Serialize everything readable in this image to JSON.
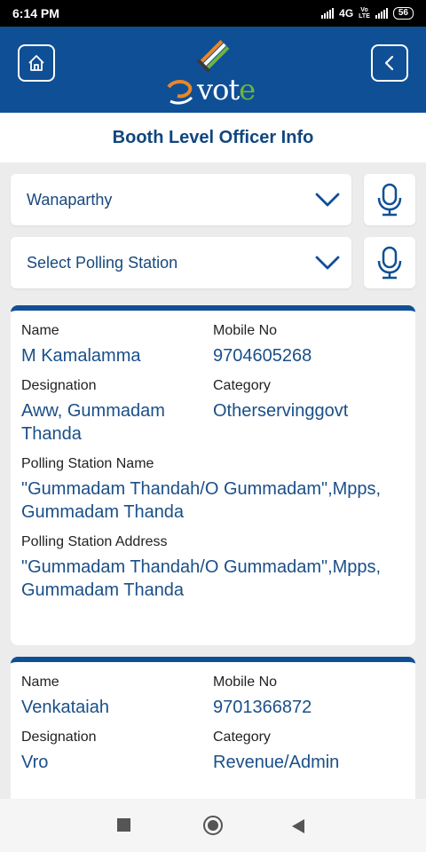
{
  "status": {
    "time": "6:14 PM",
    "network": "4G",
    "lte_top": "Vo",
    "lte_bottom": "LTE",
    "battery": "56"
  },
  "header": {
    "logo_main": "vot",
    "logo_accent": "e"
  },
  "page": {
    "title": "Booth Level Officer Info"
  },
  "filters": {
    "district": "Wanaparthy",
    "polling_station": "Select Polling Station"
  },
  "labels": {
    "name": "Name",
    "mobile": "Mobile No",
    "designation": "Designation",
    "category": "Category",
    "ps_name": "Polling Station Name",
    "ps_address": "Polling Station Address"
  },
  "officers": [
    {
      "name": "M Kamalamma",
      "mobile": "9704605268",
      "designation": "Aww, Gummadam Thanda",
      "category": "Otherservinggovt",
      "ps_name": "\"Gummadam Thandah/O Gummadam\",Mpps, Gummadam Thanda",
      "ps_address": "\"Gummadam Thandah/O Gummadam\",Mpps, Gummadam Thanda"
    },
    {
      "name": "Venkataiah",
      "mobile": "9701366872",
      "designation": "Vro",
      "category": "Revenue/Admin"
    }
  ],
  "colors": {
    "primary": "#0f4f96",
    "text_value": "#1a4f88",
    "title": "#10467e"
  }
}
